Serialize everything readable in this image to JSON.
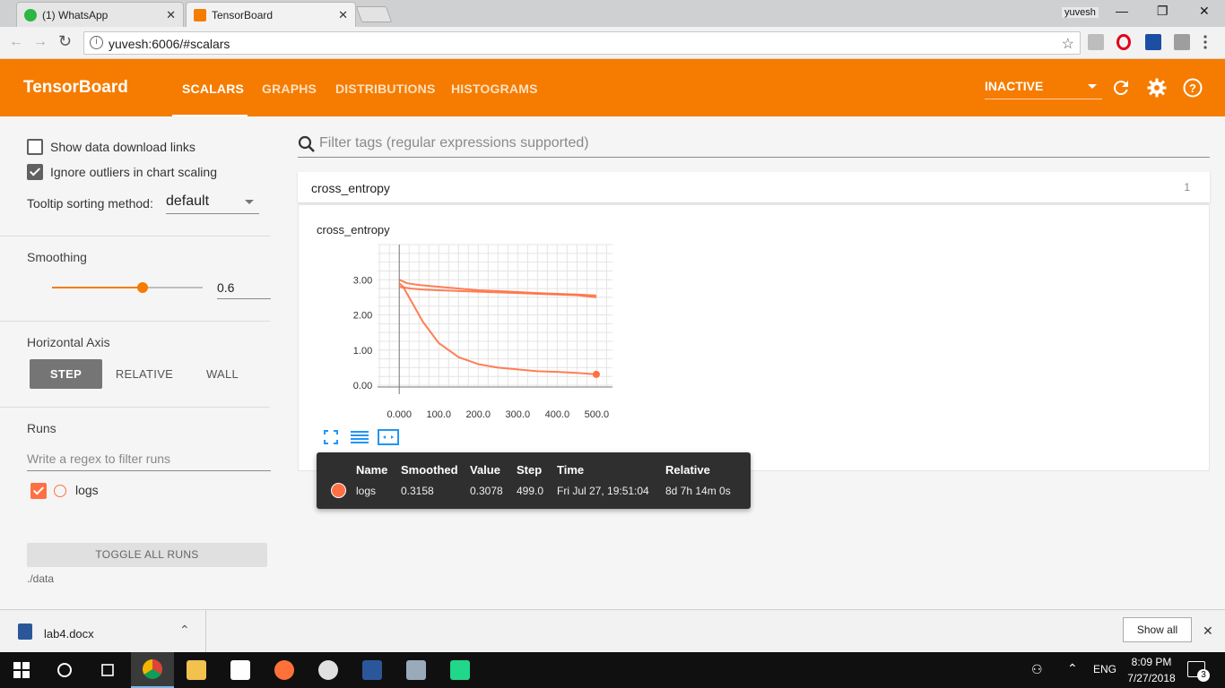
{
  "browser": {
    "tabs": [
      {
        "label": "(1) WhatsApp",
        "close": "✕"
      },
      {
        "label": "TensorBoard",
        "close": "✕"
      }
    ],
    "window_user": "yuvesh",
    "window_controls": {
      "minimize": "—",
      "maximize": "❐",
      "close": "✕"
    },
    "url": "yuvesh:6006/#scalars",
    "nav": {
      "back": "←",
      "forward": "→",
      "reload": "↻",
      "star": "☆"
    }
  },
  "tensorboard": {
    "brand": "TensorBoard",
    "nav_tabs": [
      "SCALARS",
      "GRAPHS",
      "DISTRIBUTIONS",
      "HISTOGRAMS"
    ],
    "active_tab": "SCALARS",
    "status_select": "INACTIVE",
    "colors": {
      "header": "#f57c00",
      "series": "#ff7043"
    }
  },
  "sidebar": {
    "show_download_links": {
      "label": "Show data download links",
      "checked": false
    },
    "ignore_outliers": {
      "label": "Ignore outliers in chart scaling",
      "checked": true
    },
    "tooltip_sorting": {
      "label": "Tooltip sorting method:",
      "value": "default"
    },
    "smoothing": {
      "label": "Smoothing",
      "value": "0.6",
      "fraction": 0.6
    },
    "horizontal_axis": {
      "label": "Horizontal Axis",
      "options": [
        "STEP",
        "RELATIVE",
        "WALL"
      ],
      "selected": "STEP"
    },
    "runs": {
      "label": "Runs",
      "filter_placeholder": "Write a regex to filter runs",
      "items": [
        {
          "name": "logs",
          "checked": true
        }
      ]
    },
    "toggle_all": "TOGGLE ALL RUNS",
    "data_dir": "./data"
  },
  "main": {
    "filter_placeholder": "Filter tags (regular expressions supported)",
    "group": {
      "name": "cross_entropy",
      "count": "1"
    },
    "chart_title": "cross_entropy"
  },
  "chart_data": {
    "type": "line",
    "title": "cross_entropy",
    "xlabel": "",
    "ylabel": "",
    "x_ticks": [
      "0.000",
      "100.0",
      "200.0",
      "300.0",
      "400.0",
      "500.0"
    ],
    "y_ticks": [
      "0.00",
      "1.00",
      "2.00",
      "3.00"
    ],
    "xlim": [
      -55,
      540
    ],
    "ylim": [
      -0.05,
      4.0
    ],
    "grid": true,
    "series": [
      {
        "name": "logs",
        "x": [
          0,
          10,
          20,
          40,
          60,
          80,
          100,
          150,
          200,
          250,
          300,
          350,
          400,
          450,
          499
        ],
        "y": [
          2.9,
          2.8,
          2.6,
          2.2,
          1.8,
          1.5,
          1.2,
          0.8,
          0.6,
          0.5,
          0.45,
          0.4,
          0.38,
          0.35,
          0.31
        ]
      },
      {
        "name": "logs",
        "x": [
          0,
          20,
          50,
          100,
          150,
          200,
          250,
          300,
          350,
          400,
          450,
          499
        ],
        "y": [
          3.0,
          2.9,
          2.85,
          2.8,
          2.75,
          2.7,
          2.68,
          2.65,
          2.62,
          2.6,
          2.58,
          2.55
        ]
      },
      {
        "name": "logs",
        "x": [
          0,
          30,
          60,
          100,
          150,
          200,
          250,
          300,
          350,
          400,
          450,
          499
        ],
        "y": [
          2.8,
          2.75,
          2.72,
          2.7,
          2.68,
          2.66,
          2.64,
          2.62,
          2.6,
          2.58,
          2.56,
          2.5
        ]
      }
    ],
    "tool_icons": [
      "fit-domain-icon",
      "toggle-log-scale-icon",
      "zoom-reset-icon"
    ]
  },
  "tooltip": {
    "headers": [
      "Name",
      "Smoothed",
      "Value",
      "Step",
      "Time",
      "Relative"
    ],
    "row": [
      "logs",
      "0.3158",
      "0.3078",
      "499.0",
      "Fri Jul 27, 19:51:04",
      "8d 7h 14m 0s"
    ]
  },
  "download_bar": {
    "file": "lab4.docx",
    "show_all": "Show all",
    "close": "✕",
    "expand": "⌃"
  },
  "taskbar": {
    "time": "8:09 PM",
    "date": "7/27/2018",
    "lang": "ENG",
    "notifications": "3"
  }
}
